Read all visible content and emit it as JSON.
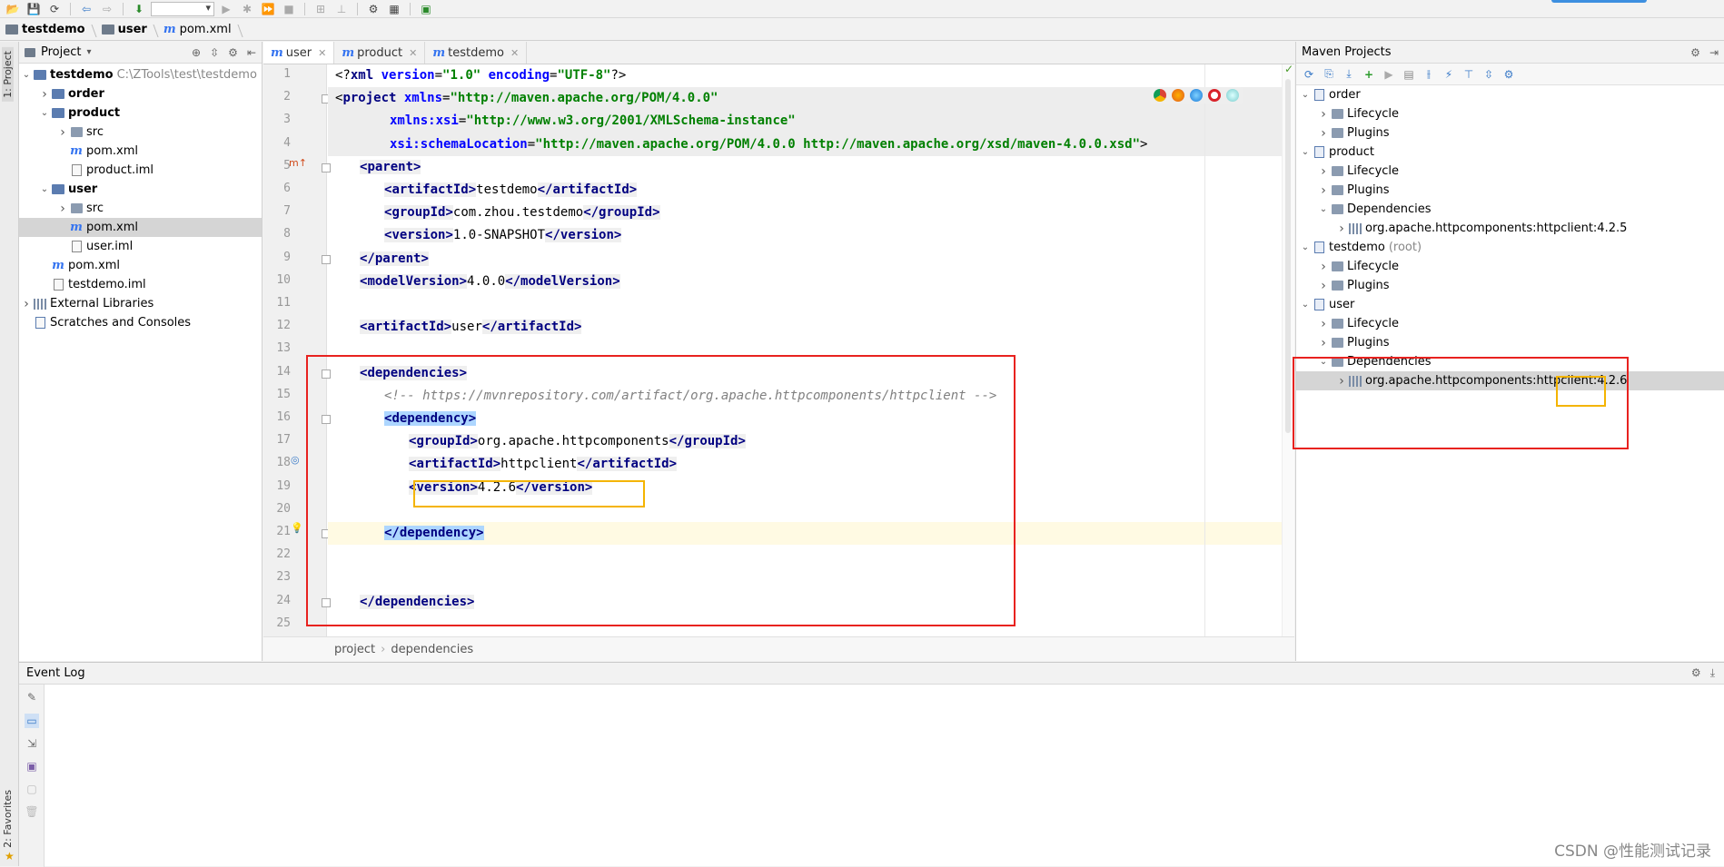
{
  "navbar": {
    "crumbs": [
      "testdemo",
      "user",
      "pom.xml"
    ]
  },
  "left_strip": {
    "project_tab": "1: Project",
    "favorites_tab": "2: Favorites"
  },
  "project_panel": {
    "title": "Project",
    "tree": [
      {
        "label": "testdemo",
        "extra": "C:\\ZTools\\test\\testdemo",
        "indent": 0,
        "expanded": true,
        "icon": "module-folder-icon",
        "bold": true
      },
      {
        "label": "order",
        "indent": 1,
        "expanded": false,
        "icon": "module-folder-icon",
        "bold": true
      },
      {
        "label": "product",
        "indent": 1,
        "expanded": true,
        "icon": "module-folder-icon",
        "bold": true
      },
      {
        "label": "src",
        "indent": 2,
        "expanded": false,
        "icon": "folder-icon"
      },
      {
        "label": "pom.xml",
        "indent": 2,
        "icon": "maven-file-icon"
      },
      {
        "label": "product.iml",
        "indent": 2,
        "icon": "iml-file-icon"
      },
      {
        "label": "user",
        "indent": 1,
        "expanded": true,
        "icon": "module-folder-icon",
        "bold": true
      },
      {
        "label": "src",
        "indent": 2,
        "expanded": false,
        "icon": "folder-icon"
      },
      {
        "label": "pom.xml",
        "indent": 2,
        "icon": "maven-file-icon",
        "selected": true
      },
      {
        "label": "user.iml",
        "indent": 2,
        "icon": "iml-file-icon"
      },
      {
        "label": "pom.xml",
        "indent": 1,
        "icon": "maven-file-icon"
      },
      {
        "label": "testdemo.iml",
        "indent": 1,
        "icon": "iml-file-icon"
      },
      {
        "label": "External Libraries",
        "indent": 0,
        "expanded": false,
        "icon": "library-icon"
      },
      {
        "label": "Scratches and Consoles",
        "indent": 0,
        "icon": "scratches-icon"
      }
    ]
  },
  "editor": {
    "tabs": [
      {
        "label": "user",
        "active": true
      },
      {
        "label": "product",
        "active": false
      },
      {
        "label": "testdemo",
        "active": false
      }
    ],
    "line_numbers": [
      "1",
      "2",
      "3",
      "4",
      "5",
      "6",
      "7",
      "8",
      "9",
      "10",
      "11",
      "12",
      "13",
      "14",
      "15",
      "16",
      "17",
      "18",
      "19",
      "20",
      "21",
      "22",
      "23",
      "24",
      "25"
    ],
    "breadcrumb": [
      "project",
      "dependencies"
    ]
  },
  "code": {
    "l1": {
      "a": "<?",
      "b": "xml ",
      "c": "version",
      "d": "=",
      "e": "\"1.0\"",
      "f": " encoding",
      "g": "=",
      "h": "\"UTF-8\"",
      "i": "?>"
    },
    "l2": {
      "open": "<",
      "tag": "project ",
      "attr": "xmlns",
      "eq": "=",
      "val": "\"http://maven.apache.org/POM/4.0.0\""
    },
    "l3": {
      "attr": "xmlns:xsi",
      "eq": "=",
      "val": "\"http://www.w3.org/2001/XMLSchema-instance\""
    },
    "l4": {
      "attr": "xsi:schemaLocation",
      "eq": "=",
      "val": "\"http://maven.apache.org/POM/4.0.0 http://maven.apache.org/xsd/maven-4.0.0.xsd\"",
      "close": ">"
    },
    "l5": "parent",
    "l6": {
      "tag": "artifactId",
      "text": "testdemo"
    },
    "l7": {
      "tag": "groupId",
      "text": "com.zhou.testdemo"
    },
    "l8": {
      "tag": "version",
      "text": "1.0-SNAPSHOT"
    },
    "l9": "parent",
    "l10": {
      "tag": "modelVersion",
      "text": "4.0.0"
    },
    "l12": {
      "tag": "artifactId",
      "text": "user"
    },
    "l14": "dependencies",
    "l15": "<!-- https://mvnrepository.com/artifact/org.apache.httpcomponents/httpclient -->",
    "l16": "dependency",
    "l17": {
      "tag": "groupId",
      "text": "org.apache.httpcomponents"
    },
    "l18": {
      "tag": "artifactId",
      "text": "httpclient"
    },
    "l19": {
      "tag": "version",
      "text": "4.2.6"
    },
    "l21": "dependency",
    "l24": "dependencies"
  },
  "maven_panel": {
    "title": "Maven Projects",
    "tree": [
      {
        "label": "order",
        "indent": 0,
        "expanded": true,
        "icon": "maven-module-icon"
      },
      {
        "label": "Lifecycle",
        "indent": 1,
        "expanded": false,
        "icon": "folder-icon"
      },
      {
        "label": "Plugins",
        "indent": 1,
        "expanded": false,
        "icon": "folder-icon"
      },
      {
        "label": "product",
        "indent": 0,
        "expanded": true,
        "icon": "maven-module-icon"
      },
      {
        "label": "Lifecycle",
        "indent": 1,
        "expanded": false,
        "icon": "folder-icon"
      },
      {
        "label": "Plugins",
        "indent": 1,
        "expanded": false,
        "icon": "folder-icon"
      },
      {
        "label": "Dependencies",
        "indent": 1,
        "expanded": true,
        "icon": "folder-icon"
      },
      {
        "label": "org.apache.httpcomponents:httpclient:4.2.5",
        "indent": 2,
        "expanded": false,
        "icon": "library-icon"
      },
      {
        "label": "testdemo",
        "extra": "(root)",
        "indent": 0,
        "expanded": true,
        "icon": "maven-module-icon"
      },
      {
        "label": "Lifecycle",
        "indent": 1,
        "expanded": false,
        "icon": "folder-icon"
      },
      {
        "label": "Plugins",
        "indent": 1,
        "expanded": false,
        "icon": "folder-icon"
      },
      {
        "label": "user",
        "indent": 0,
        "expanded": true,
        "icon": "maven-module-icon"
      },
      {
        "label": "Lifecycle",
        "indent": 1,
        "expanded": false,
        "icon": "folder-icon"
      },
      {
        "label": "Plugins",
        "indent": 1,
        "expanded": false,
        "icon": "folder-icon"
      },
      {
        "label": "Dependencies",
        "indent": 1,
        "expanded": true,
        "icon": "folder-icon"
      },
      {
        "label": "org.apache.httpcomponents:httpclient:4.2.6",
        "indent": 2,
        "expanded": false,
        "icon": "library-icon",
        "selected": true
      }
    ]
  },
  "event_log": {
    "title": "Event Log"
  },
  "watermark": "CSDN @性能测试记录",
  "colors": {
    "accent": "#3574f0",
    "annotation_red": "#e8221f",
    "annotation_orange": "#f4b400",
    "selection": "#d5d5d5"
  }
}
